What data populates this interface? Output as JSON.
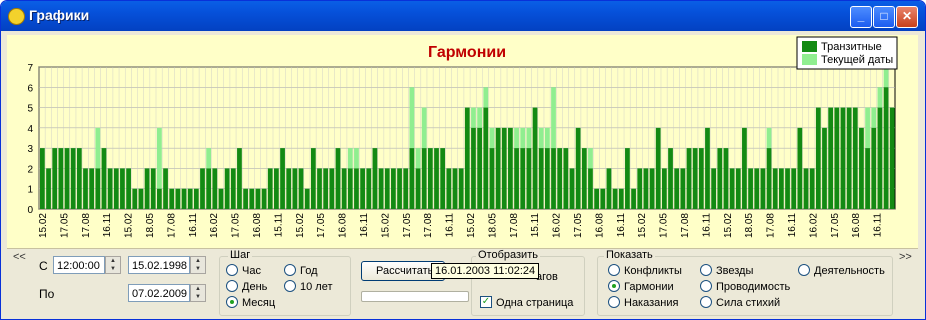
{
  "window": {
    "title": "Графики"
  },
  "colors": {
    "transit": "#138a13",
    "current": "#90ee90",
    "plot_bg": "#ffffc8",
    "title": "#c00000"
  },
  "chart_data": {
    "type": "bar",
    "title": "Гармонии",
    "ylim": [
      0,
      7
    ],
    "yticks": [
      0,
      1,
      2,
      3,
      4,
      5,
      6,
      7
    ],
    "grid": true,
    "legend_position": "top-right",
    "x_tick_labels": [
      "15.02",
      "17.05",
      "17.08",
      "16.11",
      "15.02",
      "18.05",
      "17.08",
      "16.11",
      "16.02",
      "17.05",
      "16.08",
      "15.11",
      "15.02",
      "17.05",
      "16.08",
      "16.11",
      "15.02",
      "17.05",
      "17.08",
      "16.11",
      "15.02",
      "18.05",
      "17.08",
      "15.11",
      "16.02",
      "17.05",
      "16.08",
      "16.11",
      "15.02",
      "17.05",
      "17.08",
      "16.11",
      "15.02",
      "18.05",
      "17.08",
      "16.11",
      "16.02",
      "17.05",
      "16.08",
      "16.11"
    ],
    "series": [
      {
        "name": "Транзитные",
        "values": [
          3,
          2,
          3,
          3,
          3,
          3,
          3,
          2,
          2,
          2,
          3,
          2,
          2,
          2,
          2,
          1,
          1,
          2,
          2,
          1,
          2,
          1,
          1,
          1,
          1,
          1,
          2,
          2,
          2,
          1,
          2,
          2,
          3,
          1,
          1,
          1,
          1,
          2,
          2,
          3,
          2,
          2,
          2,
          1,
          3,
          2,
          2,
          2,
          3,
          2,
          2,
          2,
          2,
          2,
          3,
          2,
          2,
          2,
          2,
          2,
          3,
          2,
          3,
          3,
          3,
          3,
          2,
          2,
          2,
          5,
          4,
          4,
          5,
          3,
          4,
          4,
          4,
          3,
          3,
          3,
          5,
          3,
          3,
          3,
          3,
          3,
          2,
          4,
          3,
          2,
          1,
          1,
          2,
          1,
          1,
          3,
          1,
          2,
          2,
          2,
          4,
          2,
          3,
          2,
          2,
          3,
          3,
          3,
          4,
          2,
          3,
          3,
          2,
          2,
          4,
          2,
          2,
          2,
          3,
          2,
          2,
          2,
          2,
          4,
          2,
          2,
          5,
          4,
          5,
          5,
          5,
          5,
          5,
          4,
          3,
          4,
          5,
          6,
          5
        ]
      },
      {
        "name": "Текущей даты",
        "values": [
          0,
          0,
          0,
          0,
          0,
          0,
          0,
          0,
          0,
          2,
          0,
          0,
          0,
          0,
          0,
          0,
          0,
          0,
          0,
          3,
          0,
          0,
          0,
          0,
          0,
          0,
          0,
          1,
          0,
          0,
          0,
          0,
          0,
          0,
          0,
          0,
          0,
          0,
          0,
          0,
          0,
          0,
          0,
          0,
          0,
          0,
          0,
          0,
          0,
          0,
          1,
          1,
          0,
          0,
          0,
          0,
          0,
          0,
          0,
          0,
          3,
          1,
          2,
          0,
          0,
          0,
          0,
          0,
          0,
          0,
          1,
          1,
          1,
          1,
          0,
          0,
          0,
          1,
          1,
          1,
          0,
          1,
          1,
          3,
          0,
          0,
          0,
          0,
          0,
          1,
          0,
          0,
          0,
          0,
          0,
          0,
          0,
          0,
          0,
          0,
          0,
          0,
          0,
          0,
          0,
          0,
          0,
          0,
          0,
          0,
          0,
          0,
          0,
          0,
          0,
          0,
          0,
          0,
          1,
          0,
          0,
          0,
          0,
          0,
          0,
          0,
          0,
          0,
          0,
          0,
          0,
          0,
          0,
          0,
          2,
          1,
          1,
          1,
          0
        ]
      }
    ]
  },
  "controls": {
    "nav_left": "<<",
    "nav_right": ">>",
    "from_label": "С",
    "from_time": "12:00:00",
    "from_date": "15.02.1998",
    "to_label": "По",
    "to_date": "07.02.2009",
    "step": {
      "title": "Шаг",
      "options": [
        "Час",
        "Год",
        "День",
        "10 лет",
        "Месяц"
      ],
      "selected": "Месяц"
    },
    "calculate_button": "Рассчитать",
    "tooltip": "16.01.2003 11:02:24",
    "display": {
      "title": "Отобразить",
      "steps_suffix": "агов",
      "one_page": "Одна страница"
    },
    "show": {
      "title": "Показать",
      "options": [
        "Конфликты",
        "Звезды",
        "Деятельность",
        "Гармонии",
        "Проводимость",
        "Наказания",
        "Сила стихий"
      ],
      "selected": "Гармонии"
    }
  }
}
